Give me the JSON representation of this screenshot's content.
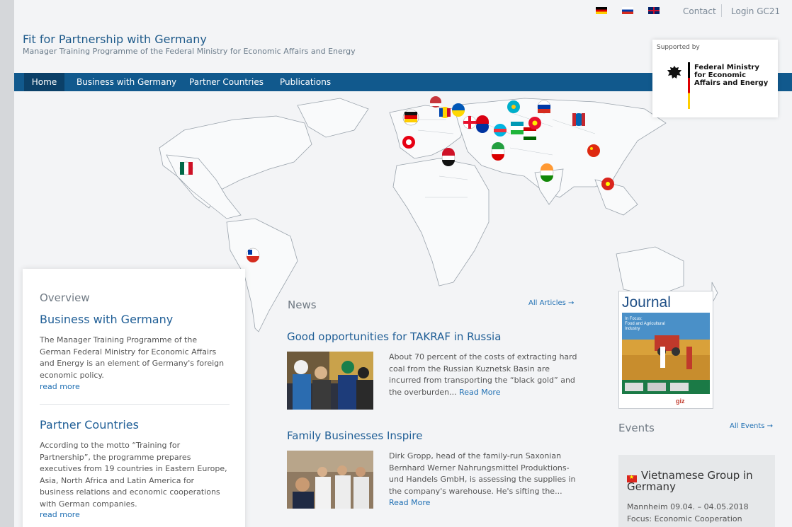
{
  "topbar": {
    "languages": [
      "German",
      "Russian",
      "English"
    ],
    "contact_label": "Contact",
    "login_label": "Login GC21"
  },
  "header": {
    "title": "Fit for Partnership with Germany",
    "subtitle": "Manager Training Programme of the Federal Ministry for Economic Affairs and Energy"
  },
  "nav": {
    "items": [
      "Home",
      "Business with Germany",
      "Partner Countries",
      "Publications"
    ],
    "active": "Home"
  },
  "support": {
    "label": "Supported by",
    "ministry": "Federal Ministry for Economic Affairs and Energy"
  },
  "overview": {
    "label": "Overview",
    "sections": [
      {
        "heading": "Business with Germany",
        "text": "The Manager Training Programme of the German Federal Ministry for Economic Affairs and Energy is an element of Germany's foreign economic policy.",
        "read_more": "read more"
      },
      {
        "heading": "Partner Countries",
        "text": "According to the motto “Training for Partnership”, the programme prepares executives from 19 countries in Eastern Europe, Asia, North Africa and Latin America for business relations and economic cooperations with German companies.",
        "read_more": "read more"
      }
    ]
  },
  "news": {
    "label": "News",
    "all_label": "All Articles →",
    "items": [
      {
        "title": "Good opportunities for TAKRAF in Russia",
        "text": "About 70 percent of the costs of extracting hard coal from the Russian Kuznetsk Basin are incurred from transporting the “black gold” and the overburden...",
        "read_more": "Read More"
      },
      {
        "title": "Family Businesses Inspire",
        "text": "Dirk Gropp, head of the family-run Saxonian Bernhard Werner Nahrungsmittel Produktions- und Handels GmbH, is assessing the supplies in the company's warehouse. He's sifting the...",
        "read_more": "Read More"
      }
    ]
  },
  "journal": {
    "title": "Journal",
    "focus_line1": "In Focus:",
    "focus_line2": "Food and Agricultural",
    "focus_line3": "Industry",
    "logo": "giz"
  },
  "events": {
    "label": "Events",
    "all_label": "All Events →",
    "items": [
      {
        "flag": "vietnam-flag",
        "title": "Vietnamese Group in Germany",
        "date": "Mannheim 09.04. – 04.05.2018",
        "focus": "Focus: Economic Cooperation"
      }
    ]
  },
  "map": {
    "pins": [
      "germany",
      "serbia",
      "moldova",
      "ukraine",
      "belarus",
      "russia",
      "kazakhstan",
      "uzbekistan",
      "kyrgyzstan",
      "mongolia",
      "georgia",
      "armenia",
      "azerbaijan",
      "tajikistan",
      "iran",
      "tunisia",
      "egypt",
      "india",
      "china",
      "vietnam",
      "mexico",
      "chile"
    ]
  },
  "colors": {
    "nav_bg": "#11598d",
    "nav_active": "#0b4068",
    "heading": "#1f5e96",
    "link": "#1f6fb3"
  }
}
